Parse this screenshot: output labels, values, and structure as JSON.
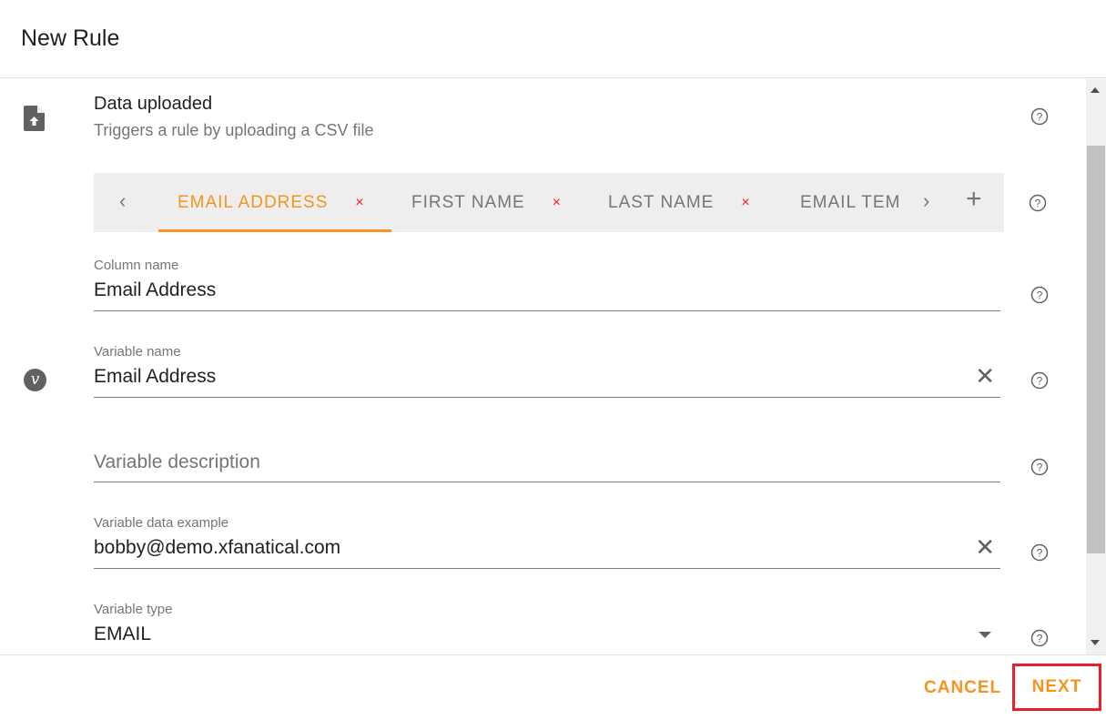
{
  "dialog": {
    "title": "New Rule"
  },
  "trigger": {
    "icon": "file-upload-icon",
    "title": "Data uploaded",
    "subtitle": "Triggers a rule by uploading a CSV file"
  },
  "tabs": {
    "prev_icon": "‹",
    "next_icon": "›",
    "add_icon": "+",
    "close_icon": "×",
    "items": [
      {
        "label": "EMAIL ADDRESS",
        "active": true
      },
      {
        "label": "FIRST NAME",
        "active": false
      },
      {
        "label": "LAST NAME",
        "active": false
      },
      {
        "label": "EMAIL TEM",
        "active": false
      }
    ]
  },
  "fields": {
    "column_name": {
      "label": "Column name",
      "value": "Email Address"
    },
    "variable_name": {
      "label": "Variable name",
      "value": "Email Address",
      "icon_glyph": "v"
    },
    "variable_description": {
      "placeholder": "Variable description",
      "value": ""
    },
    "variable_data_example": {
      "label": "Variable data example",
      "value": "bobby@demo.xfanatical.com"
    },
    "variable_type": {
      "label": "Variable type",
      "value": "EMAIL"
    }
  },
  "icons": {
    "clear": "✕",
    "help": "?"
  },
  "footer": {
    "cancel_label": "CANCEL",
    "next_label": "NEXT"
  },
  "colors": {
    "accent": "#f7931e",
    "close_red": "#ff1a1a",
    "highlight_box": "#e8202a"
  }
}
